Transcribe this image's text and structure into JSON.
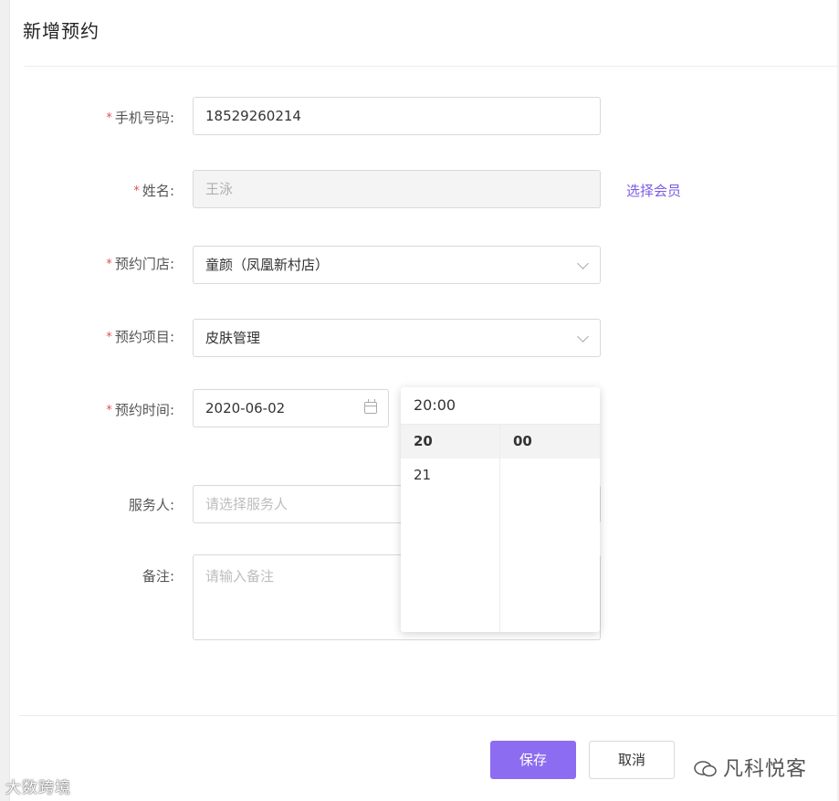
{
  "dialog": {
    "title": "新增预约"
  },
  "form": {
    "phone": {
      "label": "手机号码",
      "value": "18529260214"
    },
    "name": {
      "label": "姓名",
      "value": "王泳",
      "link": "选择会员"
    },
    "store": {
      "label": "预约门店",
      "value": "童颜（凤凰新村店）"
    },
    "service": {
      "label": "预约项目",
      "value": "皮肤管理"
    },
    "time": {
      "label": "预约时间",
      "date": "2020-06-02"
    },
    "staff": {
      "label": "服务人",
      "placeholder": "请选择服务人"
    },
    "note": {
      "label": "备注",
      "placeholder": "请输入备注"
    },
    "required_mark": "*",
    "colon": ":"
  },
  "time_picker": {
    "value": "20:00",
    "hours": [
      "20",
      "21"
    ],
    "selected_hour": "20",
    "minutes": [
      "00"
    ],
    "selected_minute": "00"
  },
  "footer": {
    "save": "保存",
    "cancel": "取消"
  },
  "watermarks": {
    "right": "凡科悦客",
    "left": "大数跨境"
  },
  "colors": {
    "primary": "#8c6cf0",
    "link": "#7b5ce6",
    "required": "#e0524f"
  }
}
